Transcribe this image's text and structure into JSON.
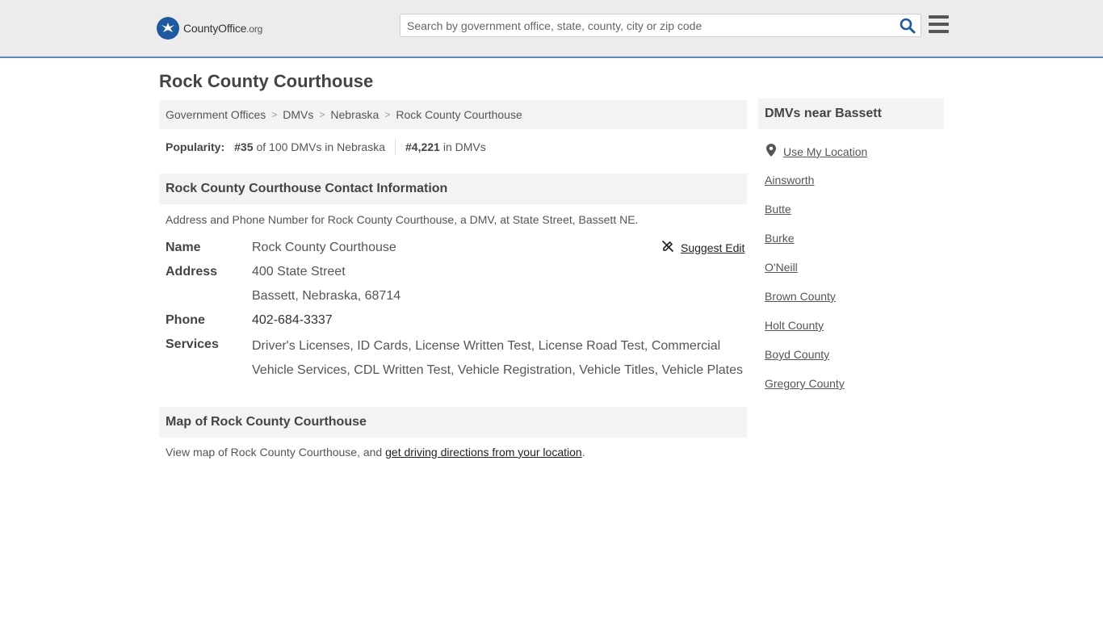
{
  "header": {
    "logo_main": "CountyOffice",
    "logo_suffix": ".org",
    "search_placeholder": "Search by government office, state, county, city or zip code",
    "search_value": ""
  },
  "page": {
    "title": "Rock County Courthouse"
  },
  "breadcrumb": [
    "Government Offices",
    "DMVs",
    "Nebraska",
    "Rock County Courthouse"
  ],
  "popularity": {
    "label": "Popularity:",
    "state_rank": "#35",
    "state_text": "of 100 DMVs in Nebraska",
    "national_rank": "#4,221",
    "national_text": "in DMVs"
  },
  "contact": {
    "heading": "Rock County Courthouse Contact Information",
    "description": "Address and Phone Number for Rock County Courthouse, a DMV, at State Street, Bassett NE.",
    "suggest_edit": "Suggest Edit",
    "name_label": "Name",
    "name_value": "Rock County Courthouse",
    "address_label": "Address",
    "address_line1": "400 State Street",
    "address_line2": "Bassett, Nebraska, 68714",
    "phone_label": "Phone",
    "phone_value": "402-684-3337",
    "services_label": "Services",
    "services_value": "Driver's Licenses, ID Cards, License Written Test, License Road Test, Commercial Vehicle Services, CDL Written Test, Vehicle Registration, Vehicle Titles, Vehicle Plates"
  },
  "map": {
    "heading": "Map of Rock County Courthouse",
    "text_before": "View map of Rock County Courthouse, and ",
    "link_text": "get driving directions from your location",
    "text_after": "."
  },
  "sidebar": {
    "heading": "DMVs near Bassett",
    "use_location": "Use My Location",
    "links": [
      "Ainsworth",
      "Butte",
      "Burke",
      "O'Neill",
      "Brown County",
      "Holt County",
      "Boyd County",
      "Gregory County"
    ]
  },
  "colors": {
    "header_bg": "#ececec",
    "header_border": "#5b88b8",
    "logo_blue": "#1f5a9e",
    "search_icon": "#1f5a9e",
    "panel_bg": "#f3f3f3"
  }
}
